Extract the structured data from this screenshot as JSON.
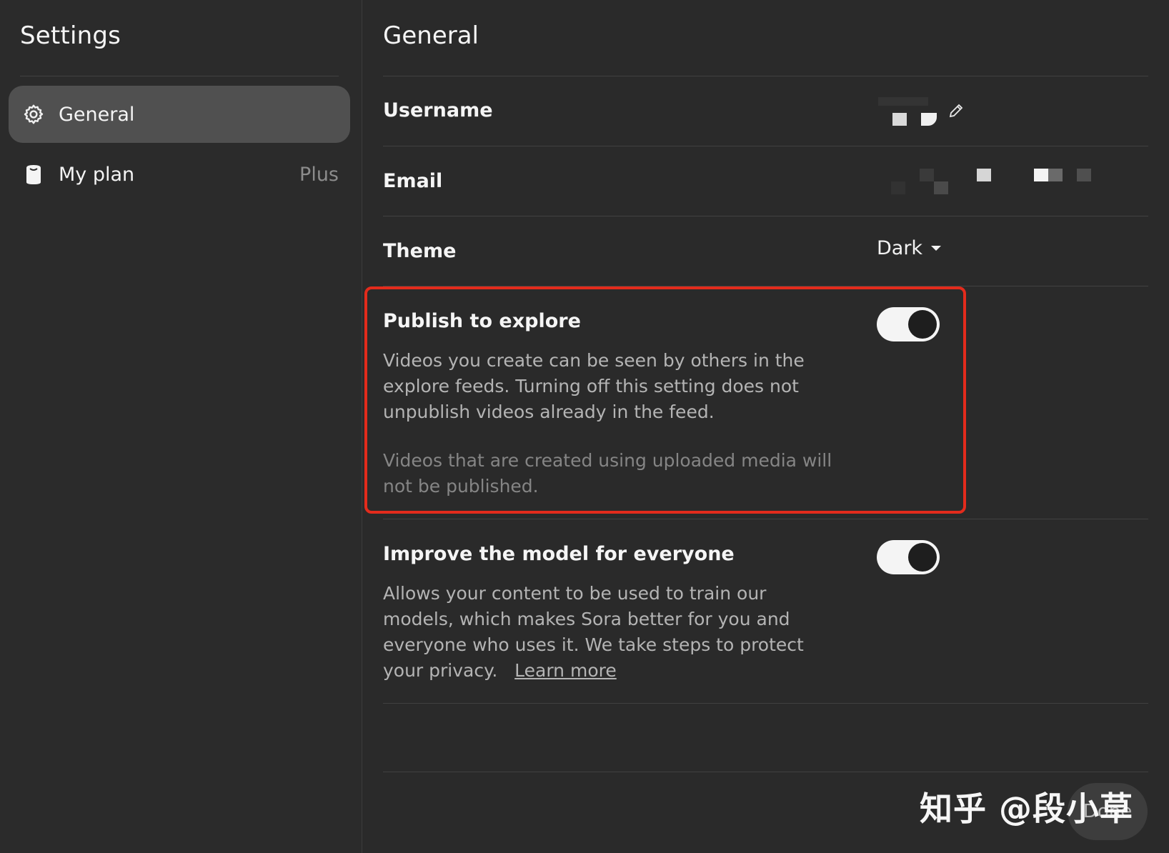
{
  "sidebar": {
    "title": "Settings",
    "items": [
      {
        "label": "General",
        "icon": "gear-icon",
        "active": true,
        "badge": ""
      },
      {
        "label": "My plan",
        "icon": "plan-icon",
        "active": false,
        "badge": "Plus"
      }
    ]
  },
  "main": {
    "title": "General",
    "username": {
      "label": "Username",
      "edit_icon": "pencil-icon"
    },
    "email": {
      "label": "Email"
    },
    "theme": {
      "label": "Theme",
      "value": "Dark"
    },
    "publish": {
      "label": "Publish to explore",
      "description": "Videos you create can be seen by others in the explore feeds. Turning off this setting does not unpublish videos already in the feed.",
      "note": "Videos that are created using uploaded media will not be published.",
      "enabled": true
    },
    "improve": {
      "label": "Improve the model for everyone",
      "description": "Allows your content to be used to train our models, which makes Sora better for you and everyone who uses it. We take steps to protect your privacy.",
      "link_label": "Learn more",
      "enabled": true
    },
    "done_label": "Done"
  },
  "watermark": "知乎 @段小草",
  "colors": {
    "background": "#2a2a2a",
    "active_nav": "#505050",
    "highlight": "#e32b1c",
    "toggle_on": "#f4f4f4"
  }
}
